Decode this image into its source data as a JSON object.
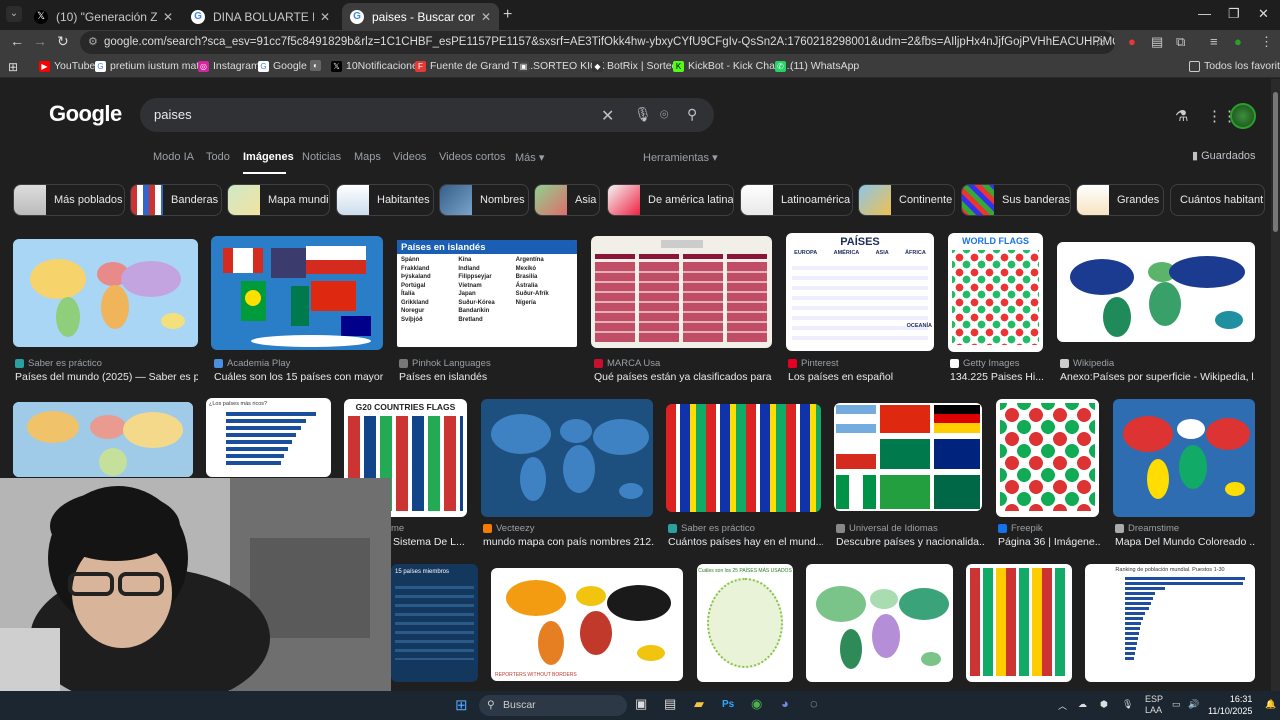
{
  "browser": {
    "tabs": [
      {
        "label": "(10) \"Generación Z\" - Buscar / X",
        "icon": "x-icon",
        "active": false
      },
      {
        "label": "DINA BOLUARTE MINISTROS - ",
        "icon": "google-icon",
        "active": false
      },
      {
        "label": "paises - Buscar con Google",
        "icon": "google-icon",
        "active": true
      }
    ],
    "new_tab_symbol": "+",
    "address": "google.com/search?sca_esv=91cc7f5c8491829b&rlz=1C1CHBF_esPE1157PE1157&sxsrf=AE3TifOkk4hw-ybxyCYfU9CFgIv-QsSn2A:1760218298001&udm=2&fbs=AIljpHx4nJjfGojPVHhEACUHPiMQht6_BFq6vBIoFFRK7qchKHDX9TtpZ992kyQ...",
    "bookmarks": [
      "YouTube",
      "pretium iustum mat...",
      "Instagram",
      "Google",
      "",
      "10Notificaciones",
      "Fuente de Grand Th...",
      "SORTEO KICK",
      "BotRix | Sorteos",
      "KickBot - Kick Chatb...",
      "(11) WhatsApp"
    ],
    "bookmarks_folder": "Todos los favoritos"
  },
  "google": {
    "logo": "Google",
    "query": "paises",
    "nav": [
      "Modo IA",
      "Todo",
      "Imágenes",
      "Noticias",
      "Maps",
      "Videos",
      "Videos cortos",
      "Más"
    ],
    "active_nav": "Imágenes",
    "tools": "Herramientas",
    "saved": "Guardados",
    "chips": [
      "Más poblados",
      "Banderas",
      "Mapa mundi",
      "Habitantes",
      "Nombres",
      "Asia",
      "De américa latina",
      "Latinoamérica",
      "Continente",
      "Sus banderas",
      "Grandes",
      "Cuántos habitant"
    ],
    "row1": [
      {
        "source": "Saber es práctico",
        "title": "Países del mundo (2025) — Saber es p..."
      },
      {
        "source": "Academia Play",
        "title": "Cuáles son los 15 países con mayor ..."
      },
      {
        "source": "Pinhok Languages",
        "title": "Países en islandés",
        "img_heading": "Países en islandés",
        "img_words": [
          "Spánn",
          "Frakkland",
          "Þýskaland",
          "Portúgal",
          "Ítalía",
          "Grikkland",
          "Noregur",
          "Svíþjóð",
          "Kína",
          "Indland",
          "Filippseyjar",
          "Víetnam",
          "Japan",
          "Suður-Kórea",
          "Bandaríkin",
          "Bretland",
          "Argentína",
          "Mexíkó",
          "Brasilía",
          "Ástralía",
          "Suður-Afrík",
          "Nígería"
        ]
      },
      {
        "source": "MARCA Usa",
        "title": "Qué países están ya clasificados para ..."
      },
      {
        "source": "Pinterest",
        "title": "Los países en español",
        "img_heading": "PAÍSES",
        "img_words": [
          "EUROPA",
          "AMÉRICA",
          "ASIA",
          "ÁFRICA",
          "OCEANÍA"
        ]
      },
      {
        "source": "Getty Images",
        "title": "134.225 Paises Hi...",
        "img_heading": "WORLD FLAGS"
      },
      {
        "source": "Wikipedia",
        "title": "Anexo:Países por superficie - Wikipedia, l..."
      }
    ],
    "row2": [
      {
        "source": "me",
        "title": "Sistema De L..."
      },
      {
        "source": "Vecteezy",
        "title": "mundo mapa con país nombres 212..."
      },
      {
        "source": "Saber es práctico",
        "title": "Cuántos países hay en el mund..."
      },
      {
        "source": "Universal de Idiomas",
        "title": "Descubre países y nacionalida..."
      },
      {
        "source": "Freepik",
        "title": "Página 36 | Imágene..."
      },
      {
        "source": "Dreamstime",
        "title": "Mapa Del Mundo Coloreado ..."
      }
    ],
    "row2_img_texts": {
      "g20": "G20 COUNTRIES FLAGS",
      "rich": "¿Los países más ricos?"
    },
    "row3_img_texts": {
      "members": "15 países miembros",
      "rsf": "REPORTERS WITHOUT BORDERS",
      "ranking": "Ranking de población mundial. Puestos 1-30",
      "most_used": "Cuáles son los 25 PAÍSES MÁS USADOS"
    }
  },
  "taskbar": {
    "search": "Buscar",
    "lang": "ESP",
    "lang2": "LAA",
    "time": "16:31",
    "date": "11/10/2025"
  },
  "colors": {
    "page_bg": "#1f1f1f",
    "accent_red": "#c8102e",
    "link_gray": "#9aa0a6",
    "ocean_blue": "#a9d6f5"
  }
}
